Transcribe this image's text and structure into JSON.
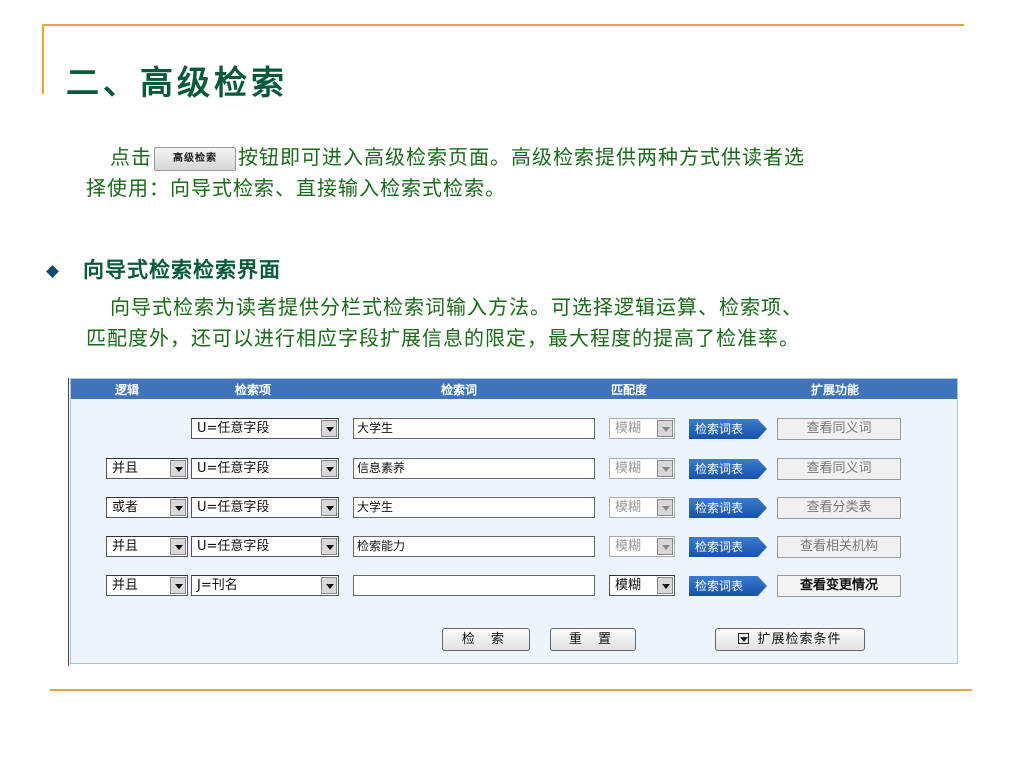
{
  "slide": {
    "title": "二、高级检索",
    "para1_before": "点击",
    "para1_button": "高级检索",
    "para1_after": "按钮即可进入高级检索页面。高级检索提供两种方式供读者选择使用：向导式检索、直接输入检索式检索。",
    "bullet": "向导式检索检索界面",
    "para3": "向导式检索为读者提供分栏式检索词输入方法。可选择逻辑运算、检索项、匹配度外，还可以进行相应字段扩展信息的限定，最大程度的提高了检准率。"
  },
  "panel": {
    "headers": {
      "logic": "逻辑",
      "field": "检索项",
      "term": "检索词",
      "match": "匹配度",
      "ext": "扩展功能"
    },
    "rows": [
      {
        "logic": "",
        "field": "U=任意字段",
        "term": "大学生",
        "match": "模糊",
        "vocab": "检索词表",
        "ext": "查看同义词"
      },
      {
        "logic": "并且",
        "field": "U=任意字段",
        "term": "信息素养",
        "match": "模糊",
        "vocab": "检索词表",
        "ext": "查看同义词"
      },
      {
        "logic": "或者",
        "field": "U=任意字段",
        "term": "大学生",
        "match": "模糊",
        "vocab": "检索词表",
        "ext": "查看分类表"
      },
      {
        "logic": "并且",
        "field": "U=任意字段",
        "term": "检索能力",
        "match": "模糊",
        "vocab": "检索词表",
        "ext": "查看相关机构"
      },
      {
        "logic": "并且",
        "field": "J=刊名",
        "term": "",
        "match": "模糊",
        "vocab": "检索词表",
        "ext": "查看变更情况"
      }
    ],
    "buttons": {
      "search": "检 索",
      "reset": "重 置",
      "expand": "扩展检索条件"
    }
  },
  "colors": {
    "frame": "#e2a93a",
    "title": "#0a5a3a",
    "body_text": "#1a6a1a",
    "panel_header": "#3f74b8",
    "vocab_button": "#1552a8"
  }
}
